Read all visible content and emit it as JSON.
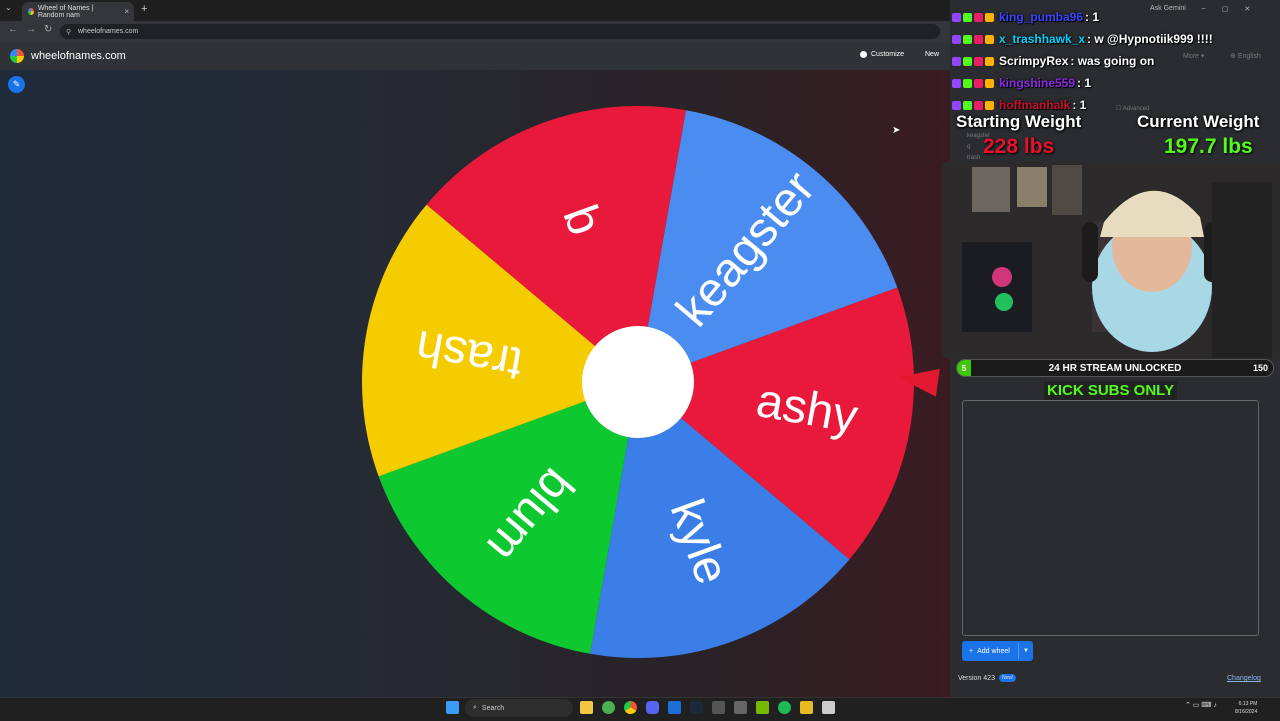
{
  "browser": {
    "tab_title": "Wheel of Names | Random nam",
    "url": "wheelofnames.com",
    "controls_label": "Ask Gemini"
  },
  "app": {
    "title": "wheelofnames.com",
    "customize_label": "Customize",
    "new_label": "New",
    "more_label": "More",
    "language_label": "English",
    "add_wheel_label": "Add wheel",
    "version_label": "Version 423",
    "new_badge": "New!",
    "changelog_label": "Changelog",
    "ghost_entries": [
      "keagster",
      "q",
      "trash"
    ],
    "ghost_advanced": "Advanced",
    "wheel_entries": [
      "keagster",
      "ashy",
      "kyle",
      "blum",
      "trash",
      "q"
    ],
    "wheel_colors": [
      "#4a8cf0",
      "#e8193a",
      "#3c7ee8",
      "#0ec830",
      "#f5cc00",
      "#e8193a"
    ]
  },
  "chat": [
    {
      "user": "king_pumba96",
      "message": ": 1",
      "user_color": "#3a44ff"
    },
    {
      "user": "x_trashhawk_x",
      "message": ": w @Hypnotiik999 !!!!",
      "user_color": "#00d3ff"
    },
    {
      "user": "ScrimpyRex",
      "message": ": was going on",
      "user_color": "#ffffff"
    },
    {
      "user": "kingshine559",
      "message": ": 1",
      "user_color": "#8a2be2"
    },
    {
      "user": "hoffmanhalk",
      "message": ": 1",
      "user_color": "#c8102e"
    }
  ],
  "stream": {
    "starting_weight_label": "Starting Weight",
    "starting_weight_value": "228 lbs",
    "current_weight_label": "Current Weight",
    "current_weight_value": "197.7 lbs",
    "goal_current": "5",
    "goal_text": "24 HR STREAM UNLOCKED",
    "goal_target": "150",
    "goal_progress": 0.033,
    "banner": "KICK SUBS ONLY"
  },
  "taskbar": {
    "search_label": "Search",
    "time": "6:13 PM",
    "date": "8/16/2024"
  }
}
